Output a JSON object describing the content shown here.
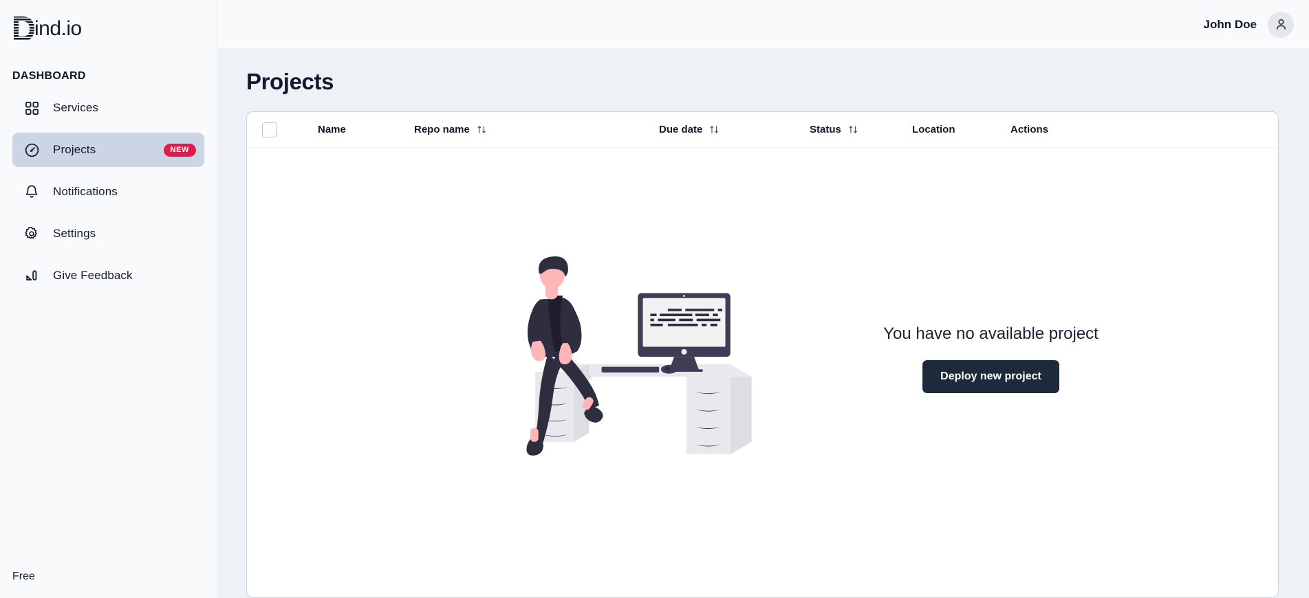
{
  "brand": {
    "logo_text": "ind.io",
    "logo_icon": "striped-d-logo"
  },
  "sidebar": {
    "section_title": "DASHBOARD",
    "items": [
      {
        "label": "Services",
        "icon": "grid-icon",
        "active": false,
        "badge": ""
      },
      {
        "label": "Projects",
        "icon": "gauge-icon",
        "active": true,
        "badge": "NEW"
      },
      {
        "label": "Notifications",
        "icon": "bell-icon",
        "active": false,
        "badge": ""
      },
      {
        "label": "Settings",
        "icon": "gear-icon",
        "active": false,
        "badge": ""
      },
      {
        "label": "Give Feedback",
        "icon": "pencil-square-icon",
        "active": false,
        "badge": ""
      }
    ],
    "plan_label": "Free"
  },
  "topbar": {
    "user_name": "John Doe",
    "avatar_icon": "user-icon"
  },
  "page": {
    "title": "Projects"
  },
  "table": {
    "columns": [
      {
        "label": "Name",
        "sortable": false
      },
      {
        "label": "Repo name",
        "sortable": true
      },
      {
        "label": "Due date",
        "sortable": true
      },
      {
        "label": "Status",
        "sortable": true
      },
      {
        "label": "Location",
        "sortable": false
      },
      {
        "label": "Actions",
        "sortable": false
      }
    ],
    "rows": []
  },
  "empty_state": {
    "message": "You have no available project",
    "cta_label": "Deploy new project",
    "illustration": "person-sitting-at-desk-illustration"
  },
  "colors": {
    "accent_badge": "#e21b4c",
    "button_dark": "#1d2a3c",
    "sidebar_bg": "#f8fafc",
    "main_bg": "#eef2f7",
    "active_nav": "#ccd5e4"
  }
}
